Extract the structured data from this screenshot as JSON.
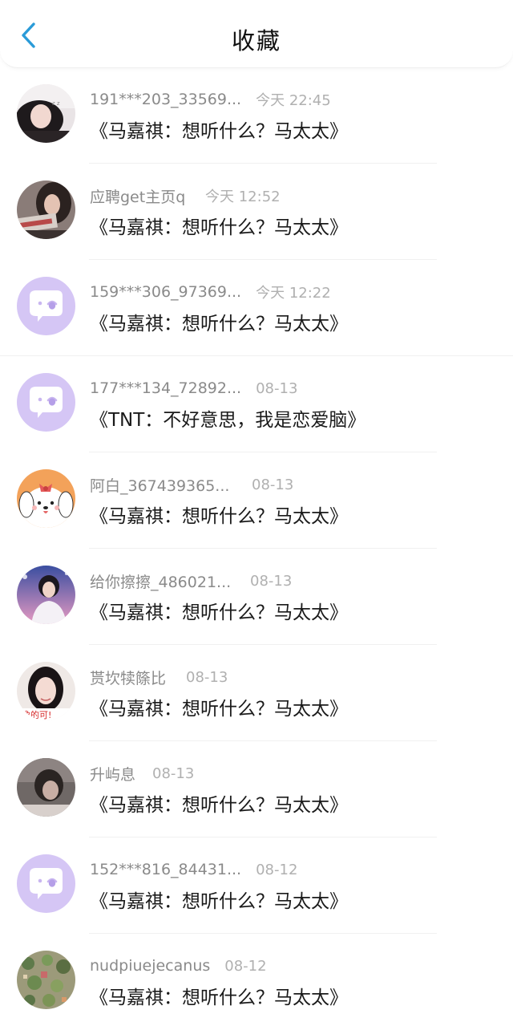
{
  "header": {
    "back_icon": "chevron-left-icon",
    "title": "收藏"
  },
  "colors": {
    "accent": "#2a9bd8",
    "default_avatar_bg": "#d5c6f5"
  },
  "items": [
    {
      "username": "191***203_33569...",
      "time": "今天 22:45",
      "message": "《马嘉祺：想听什么？马太太》",
      "avatar": "photo-girl-lying"
    },
    {
      "username": "应聘get主页q",
      "time": "今天 12:52",
      "message": "《马嘉祺：想听什么？马太太》",
      "avatar": "photo-girl-reading"
    },
    {
      "username": "159***306_97369...",
      "time": "今天 12:22",
      "message": "《马嘉祺：想听什么？马太太》",
      "avatar": "default-chat-bubble"
    },
    {
      "username": "177***134_72892...",
      "time": "08-13",
      "message": "《TNT：不好意思，我是恋爱脑》",
      "avatar": "default-chat-bubble"
    },
    {
      "username": "阿白_367439365...",
      "time": "08-13",
      "message": "《马嘉祺：想听什么？马太太》",
      "avatar": "cartoon-dog"
    },
    {
      "username": "给你擦擦_486021...",
      "time": "08-13",
      "message": "《马嘉祺：想听什么？马太太》",
      "avatar": "photo-boy-stage"
    },
    {
      "username": "贳坎犊篨比",
      "time": "08-13",
      "message": "《马嘉祺：想听什么？马太太》",
      "avatar": "photo-girl-red-text"
    },
    {
      "username": "升屿息",
      "time": "08-13",
      "message": "《马嘉祺：想听什么？马太太》",
      "avatar": "photo-person-dark"
    },
    {
      "username": "152***816_84431...",
      "time": "08-12",
      "message": "《马嘉祺：想听什么？马太太》",
      "avatar": "default-chat-bubble"
    },
    {
      "username": "nudpiuejecanus",
      "time": "08-12",
      "message": "《马嘉祺：想听什么？马太太》",
      "avatar": "photo-plants"
    }
  ]
}
